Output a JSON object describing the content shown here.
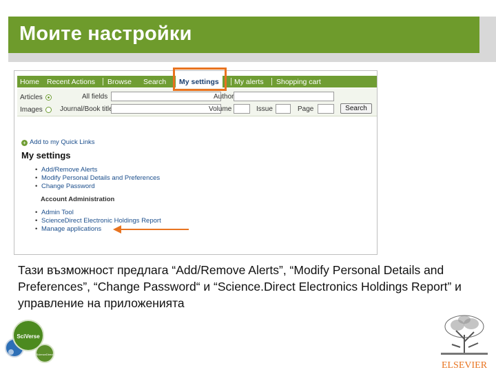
{
  "slide": {
    "title": "Моите настройки",
    "description": "Тази възможност предлага “Add/Remove Alerts”, “Modify Personal Details and Preferences”, “Change Password“ и “Science.Direct Electronics Holdings Report” и управление на приложенията"
  },
  "nav": {
    "tabs": [
      "Home",
      "Recent Actions",
      "Browse",
      "Search",
      "My settings",
      "My alerts",
      "Shopping cart"
    ],
    "active": "My settings"
  },
  "search": {
    "type_articles": "Articles",
    "type_images": "Images",
    "all_fields": "All fields",
    "author": "Author",
    "journal": "Journal/Book title",
    "volume": "Volume",
    "issue": "Issue",
    "page": "Page",
    "button": "Search"
  },
  "content": {
    "quick_link": "Add to my Quick Links",
    "heading": "My settings",
    "items": [
      "Add/Remove Alerts",
      "Modify Personal Details and Preferences",
      "Change Password"
    ],
    "admin_heading": "Account Administration",
    "admin_items": [
      "Admin Tool",
      "ScienceDirect Electronic Holdings Report",
      "Manage applications"
    ]
  },
  "logos": {
    "sciverse": "SciVerse",
    "sciencedirect": "ScienceDirect",
    "elsevier": "ELSEVIER"
  },
  "colors": {
    "title_bar": "#6e9b2c",
    "nav_bar": "#6f9d33",
    "highlight": "#e8731f",
    "link": "#1b4e8c"
  }
}
